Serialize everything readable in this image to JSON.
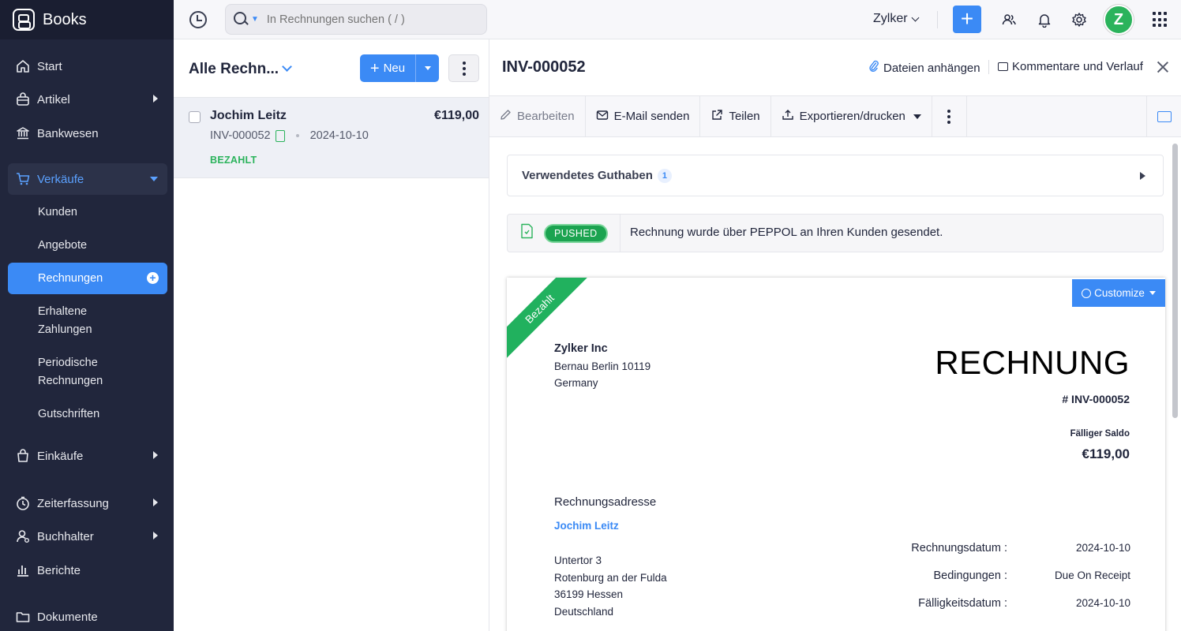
{
  "app": {
    "name": "Books"
  },
  "sidebar": {
    "items": [
      {
        "label": "Start",
        "icon": "home-icon"
      },
      {
        "label": "Artikel",
        "icon": "bag-icon"
      },
      {
        "label": "Bankwesen",
        "icon": "bank-icon"
      },
      {
        "label": "Verkäufe",
        "icon": "cart-icon"
      },
      {
        "label": "Einkäufe",
        "icon": "purchase-bag-icon"
      },
      {
        "label": "Zeiterfassung",
        "icon": "clock-icon"
      },
      {
        "label": "Buchhalter",
        "icon": "accountant-icon"
      },
      {
        "label": "Berichte",
        "icon": "chart-icon"
      },
      {
        "label": "Dokumente",
        "icon": "folder-icon"
      }
    ],
    "sales_sub": [
      {
        "label": "Kunden"
      },
      {
        "label": "Angebote"
      },
      {
        "label": "Rechnungen"
      },
      {
        "label_1": "Erhaltene",
        "label_2": "Zahlungen"
      },
      {
        "label_1": "Periodische",
        "label_2": "Rechnungen"
      },
      {
        "label": "Gutschriften"
      }
    ]
  },
  "topbar": {
    "search_placeholder": "In Rechnungen suchen ( / )",
    "org_name": "Zylker",
    "avatar_letter": "Z",
    "accent": "#3b8af5"
  },
  "list": {
    "view_title": "Alle Rechn...",
    "new_label": "Neu",
    "rows": [
      {
        "customer": "Jochim Leitz",
        "amount": "€119,00",
        "number": "INV-000052",
        "date": "2024-10-10",
        "status": "BEZAHLT"
      }
    ]
  },
  "detail": {
    "title": "INV-000052",
    "attach_label": "Dateien anhängen",
    "comments_label": "Kommentare und Verlauf",
    "toolbar": {
      "edit": "Bearbeiten",
      "email": "E-Mail senden",
      "share": "Teilen",
      "export": "Exportieren/drucken"
    },
    "credits_label": "Verwendetes Guthaben",
    "credits_count": "1",
    "peppol_badge": "PUSHED",
    "peppol_text": "Rechnung wurde über PEPPOL an Ihren Kunden gesendet."
  },
  "invoice": {
    "ribbon": "Bezahlt",
    "customize_label": "Customize",
    "org_name": "Zylker Inc",
    "org_address_1": "Bernau Berlin 10119",
    "org_address_2": "Germany",
    "doc_title": "RECHNUNG",
    "number": "# INV-000052",
    "balance_label": "Fälliger Saldo",
    "balance": "€119,00",
    "bill_to_label": "Rechnungsadresse",
    "bill_to_name": "Jochim Leitz",
    "address_1": "Untertor 3",
    "address_2": "Rotenburg an der Fulda",
    "address_3": "36199 Hessen",
    "address_4": "Deutschland",
    "meta": [
      {
        "label": "Rechnungsdatum :",
        "value": "2024-10-10"
      },
      {
        "label": "Bedingungen :",
        "value": "Due On Receipt"
      },
      {
        "label": "Fälligkeitsdatum :",
        "value": "2024-10-10"
      }
    ],
    "paid_color": "#21b15e"
  }
}
